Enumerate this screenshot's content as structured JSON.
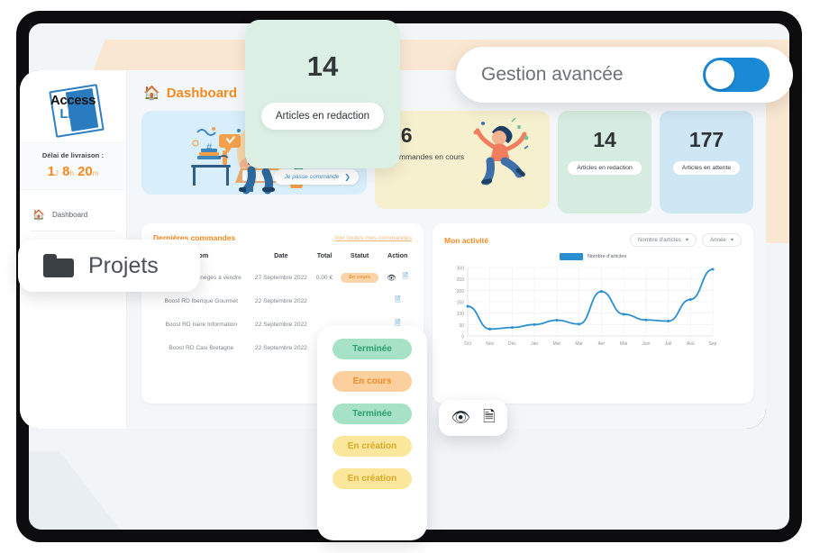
{
  "brand": {
    "logo_line1": "Access",
    "logo_line2": "Link"
  },
  "sidebar": {
    "delai_label": "Délai de livraison :",
    "timer": {
      "days": "1",
      "days_unit": "J",
      "hours": "8",
      "hours_unit": "h",
      "minutes": "20",
      "minutes_unit": "m"
    },
    "items": [
      {
        "label": "Dashboard",
        "icon": "home-icon"
      },
      {
        "label": "",
        "icon": "menu-icon"
      },
      {
        "label": "",
        "icon": "menu-icon"
      }
    ]
  },
  "header": {
    "title": "Dashboard",
    "icon": "home-icon"
  },
  "hero": {
    "cta": "Je passe commande",
    "cta_icon": "chevron-right-icon"
  },
  "stats": [
    {
      "value": "26",
      "label": "Commandes en cours",
      "color": "#f6f0cf"
    },
    {
      "value": "14",
      "label": "Articles en redaction",
      "color": "#d6ece0"
    },
    {
      "value": "177",
      "label": "Articles en attente",
      "color": "#cfe6f5"
    }
  ],
  "orders": {
    "title": "Dernières commandes",
    "link": "Voir toutes mes commandes",
    "columns": [
      "Nom",
      "Date",
      "Total",
      "Statut",
      "Action"
    ],
    "rows": [
      {
        "nom": "Lancement Manèges à vendre",
        "date": "27 Septembre 2022",
        "total": "0.00 €",
        "statut": "En cours"
      },
      {
        "nom": "Boost RD Iberique Gourmet",
        "date": "22 Septembre 2022",
        "total": "",
        "statut": ""
      },
      {
        "nom": "Boost RD Isere Information",
        "date": "22 Septembre 2022",
        "total": "",
        "statut": ""
      },
      {
        "nom": "Boost RD Casi Bretagne",
        "date": "22 Septembre 2022",
        "total": "",
        "statut": ""
      }
    ],
    "action_icons": [
      "eye-icon",
      "invoice-icon"
    ]
  },
  "activity": {
    "title": "Mon activité",
    "dropdown_metric": "Nombre d'articles",
    "dropdown_period": "Année",
    "legend": "Nombre d'articles"
  },
  "chart_data": {
    "type": "line",
    "title": "Mon activité",
    "xlabel": "",
    "ylabel": "",
    "categories": [
      "Oct",
      "Nov",
      "Déc",
      "Jan",
      "Mar",
      "Mar",
      "Avr",
      "Mai",
      "Juin",
      "Juil",
      "Aoû",
      "Sep"
    ],
    "series": [
      {
        "name": "Nombre d'articles",
        "color": "#2a8fd0",
        "values": [
          130,
          30,
          37,
          50,
          69,
          52,
          195,
          95,
          70,
          65,
          160,
          292
        ]
      }
    ],
    "ylim": [
      0,
      300
    ],
    "yticks": [
      0,
      50,
      100,
      150,
      200,
      250,
      300
    ],
    "grid": true,
    "legend_position": "top-center"
  },
  "overlays": {
    "redaction_card": {
      "value": "14",
      "label": "Articles en redaction"
    },
    "gestion": {
      "label": "Gestion avancée",
      "toggle_state": "on"
    },
    "projets": {
      "label": "Projets",
      "icon": "folder-icon"
    },
    "status_badges": [
      {
        "label": "Terminée",
        "style": "mint"
      },
      {
        "label": "En cours",
        "style": "peach"
      },
      {
        "label": "Terminée",
        "style": "mint"
      },
      {
        "label": "En création",
        "style": "yellow"
      },
      {
        "label": "En création",
        "style": "yellow"
      }
    ],
    "actions": {
      "icons": [
        "eye-icon",
        "invoice-icon"
      ]
    }
  }
}
